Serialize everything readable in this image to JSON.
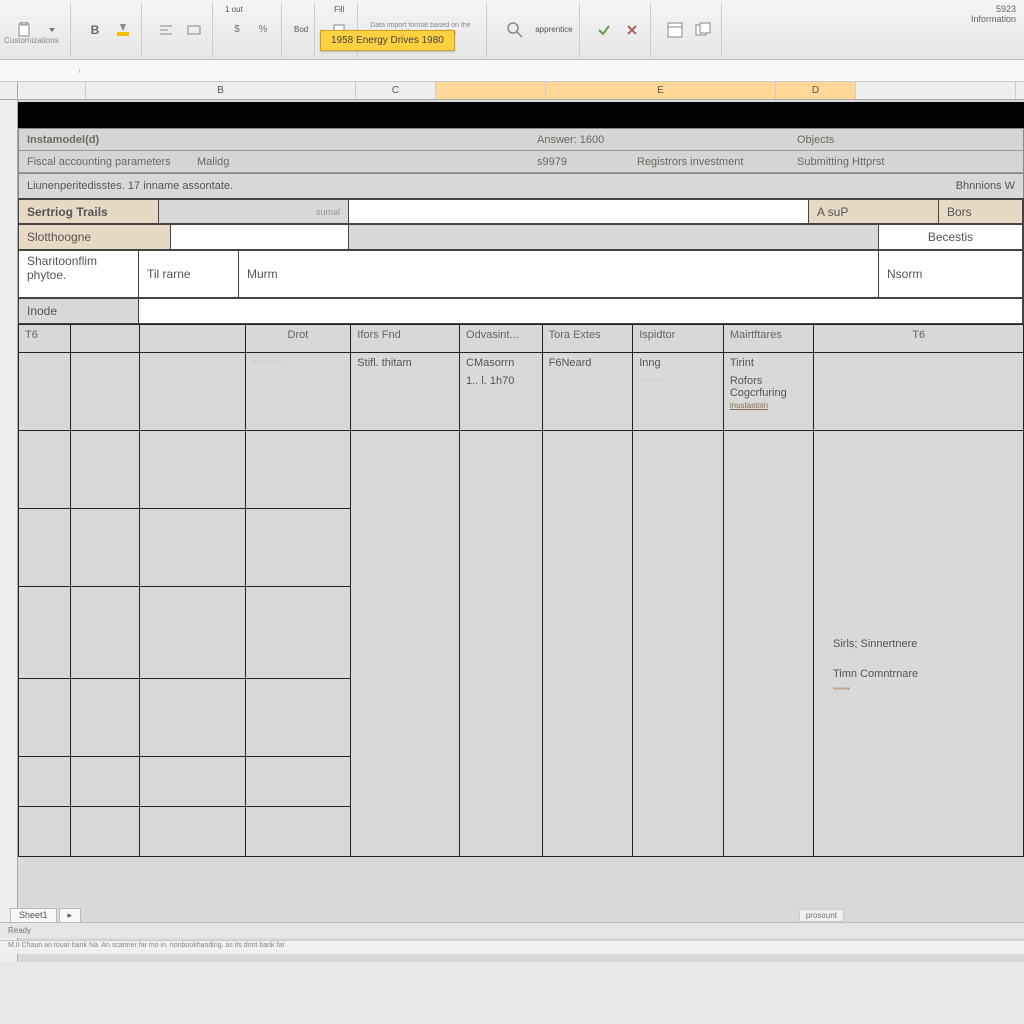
{
  "ribbon": {
    "quick_label": "Customizations",
    "highlight_tab": "1958  Energy Drives 1980",
    "text_block1": "Data import format based on the template defined for this file",
    "text_block2": "Bod",
    "text_block3": "1 out",
    "text_block4": "Fill",
    "text_block5": "apprentice",
    "right_value": "5923",
    "right_label": "Information"
  },
  "name_box": "",
  "columns": {
    "b": "B",
    "c": "C",
    "d": "D",
    "e": "E",
    "sel_start": 546,
    "sel_end": 860
  },
  "info": {
    "row1_a": "Instamodel(d)",
    "row1_b": "Answer: 1600",
    "row1_c": "Objects",
    "row2_a": "Fiscal accounting parameters",
    "row2_b": "Malidg",
    "row2_c": "s9979",
    "row2_d": "Registrors investment",
    "row2_e": "Submitting Httprst"
  },
  "section_bar": {
    "left": "Liunenperitedisstes. 17 inname assontate.",
    "right": "Bhnnions W"
  },
  "headers": {
    "service_trials": "Sertriog Trails",
    "a_sup": "A suP",
    "bors": "Bors",
    "slot_range": "Slotthoogne",
    "results": "Becestis",
    "mid_label": "sumal"
  },
  "subrow": {
    "c1": "Sharitoonflim",
    "c1b": "phytoe.",
    "c2": "Til rarne",
    "c3": "Murm",
    "c_right": "Nsorm"
  },
  "mode_label": "Inode",
  "grid_headers": [
    "T6",
    "",
    "",
    "Drot",
    "Ifors Fnd",
    "Odvasint...",
    "Tora Extes",
    "Ispidtor",
    "Mairtftares",
    "T6"
  ],
  "grid_row1": [
    "",
    "",
    "",
    "",
    "Stifl. thitam",
    "CMasorrn",
    "F6Neard",
    "Inng",
    "Tirint",
    ""
  ],
  "grid_row1b": [
    "",
    "",
    "",
    "",
    "",
    "1..  l.  1h70",
    "",
    "",
    "Rofors Cogcrfuring",
    ""
  ],
  "grid_row1c_link": "inustastoin",
  "grid_cell_notes": {
    "r4c9a": "Sirls; Sinnertnere",
    "r4c9b": "Timn Comntrnare"
  },
  "status": {
    "sheet_tab": "Sheet1",
    "ready": "Ready",
    "zoom": "prosount"
  },
  "footer_text": "M.II   Chaun  an touar bank  Na. An scanner far mo  in.  nonbookhanding.  as its dont bank fat"
}
